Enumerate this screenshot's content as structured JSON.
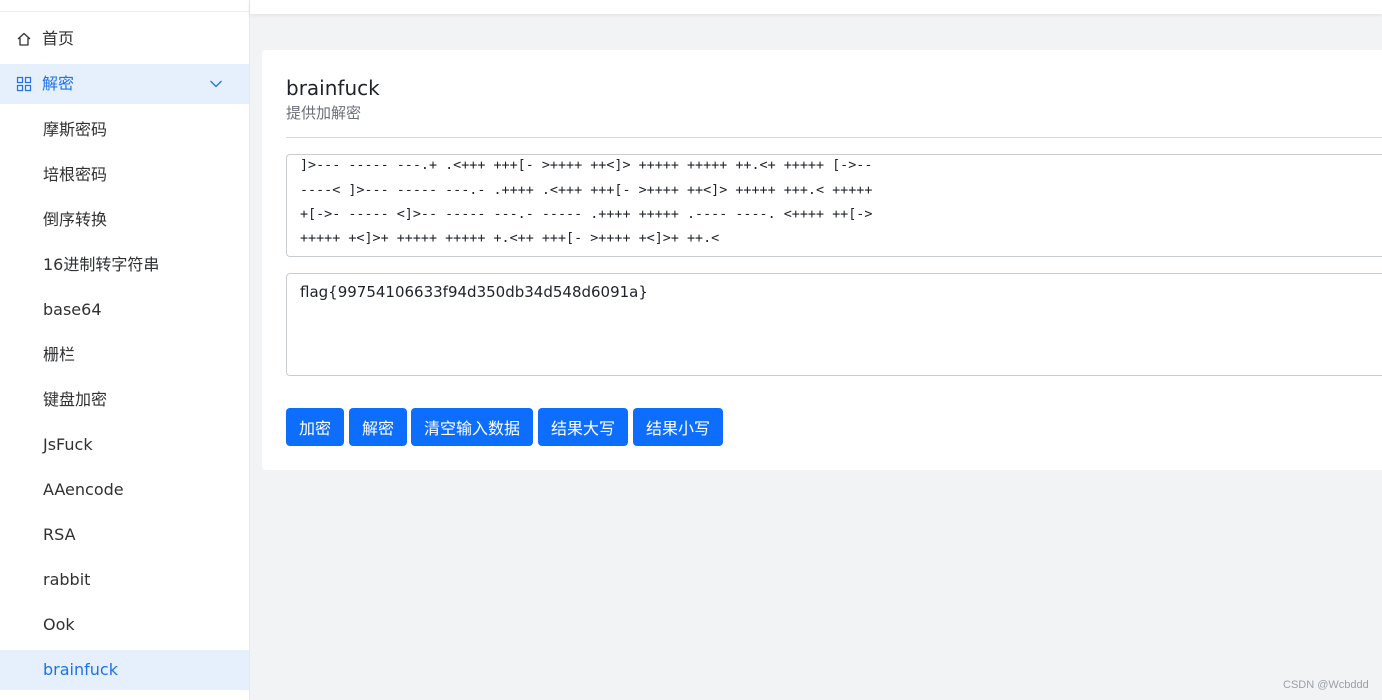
{
  "sidebar": {
    "home_label": "首页",
    "group_label": "解密",
    "items": [
      {
        "label": "摩斯密码"
      },
      {
        "label": "培根密码"
      },
      {
        "label": "倒序转换"
      },
      {
        "label": "16进制转字符串"
      },
      {
        "label": "base64"
      },
      {
        "label": "栅栏"
      },
      {
        "label": "键盘加密"
      },
      {
        "label": "JsFuck"
      },
      {
        "label": "AAencode"
      },
      {
        "label": "RSA"
      },
      {
        "label": "rabbit"
      },
      {
        "label": "Ook"
      },
      {
        "label": "brainfuck"
      }
    ],
    "active_item": "brainfuck"
  },
  "card": {
    "title": "brainfuck",
    "subtitle": "提供加解密"
  },
  "input": {
    "lines": [
      "]>--- ----- ---.+ .<+++ +++[- >++++ ++<]> +++++ +++++ ++.<+ +++++ [->--",
      "----< ]>--- ----- ---.- .++++ .<+++ +++[- >++++ ++<]> +++++ +++.< +++++",
      "+[->- ----- <]>-- ----- ---.- ----- .++++ +++++ .---- ----. <++++ ++[->",
      "+++++ +<]>+ +++++ +++++ +.<++ +++[- >++++ +<]>+ ++.<"
    ]
  },
  "output": {
    "value": "flag{99754106633f94d350db34d548d6091a}"
  },
  "buttons": {
    "encrypt": "加密",
    "decrypt": "解密",
    "clear": "清空输入数据",
    "upper": "结果大写",
    "lower": "结果小写"
  },
  "watermark": "CSDN @Wcbddd",
  "colors": {
    "accent": "#0d6efd",
    "active_bg": "#e6f0fd",
    "active_text": "#1a73e8"
  }
}
